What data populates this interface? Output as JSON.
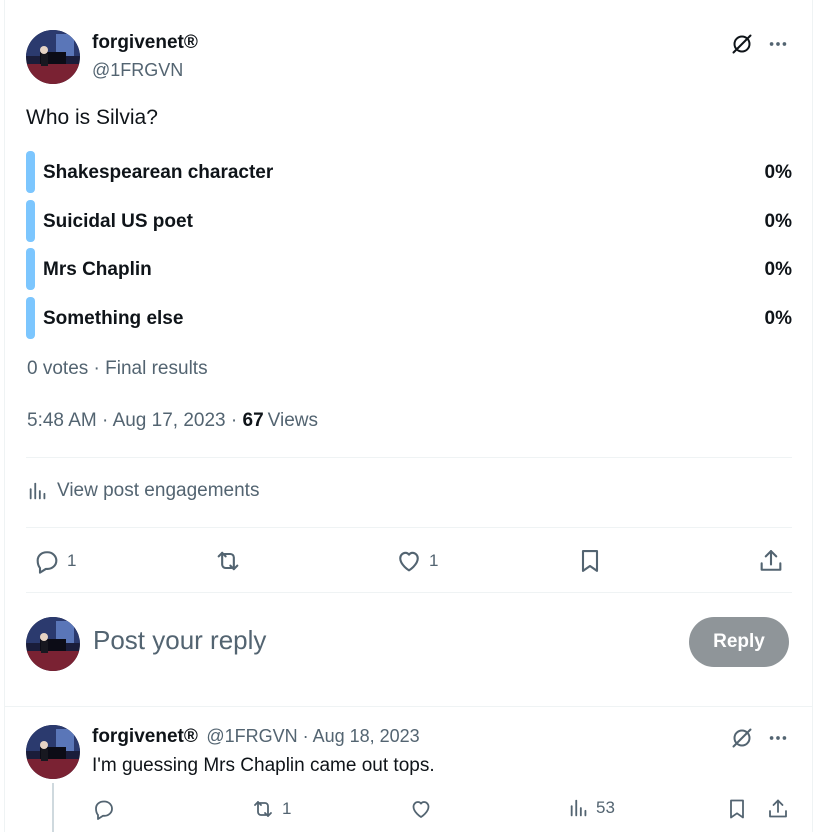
{
  "post": {
    "display_name": "forgivenet®",
    "handle": "@1FRGVN",
    "text": "Who is Silvia?",
    "poll": {
      "options": [
        {
          "label": "Shakespearean character",
          "percent": "0%",
          "fraction": 0
        },
        {
          "label": "Suicidal US poet",
          "percent": "0%",
          "fraction": 0
        },
        {
          "label": "Mrs Chaplin",
          "percent": "0%",
          "fraction": 0
        },
        {
          "label": "Something else",
          "percent": "0%",
          "fraction": 0
        }
      ],
      "summary": "0 votes · Final results"
    },
    "time": "5:48 AM",
    "separator": "·",
    "date": "Aug 17, 2023",
    "views_count": "67",
    "views_label": "Views",
    "engagements_label": "View post engagements",
    "actions": {
      "replies": "1",
      "reposts": "",
      "likes": "1"
    }
  },
  "composer": {
    "placeholder": "Post your reply",
    "button_label": "Reply"
  },
  "reply": {
    "display_name": "forgivenet®",
    "meta": "@1FRGVN · Aug 18, 2023",
    "text": "I'm guessing Mrs Chaplin came out tops.",
    "actions": {
      "replies": "",
      "reposts": "1",
      "likes": "",
      "views": "53"
    }
  },
  "colors": {
    "poll_bar": "#7cc6fe",
    "reply_button_bg": "#8f9599",
    "muted_text": "#536471"
  },
  "icons": [
    "more-icon",
    "grok-icon",
    "reply-icon",
    "repost-icon",
    "like-icon",
    "bookmark-icon",
    "share-icon",
    "analytics-icon"
  ]
}
